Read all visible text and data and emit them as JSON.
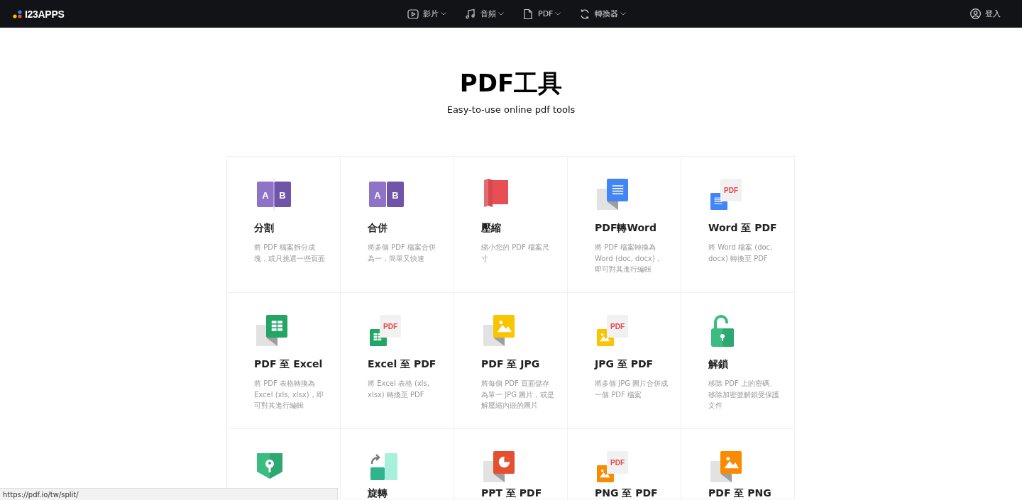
{
  "header": {
    "logo": "I23APPS",
    "nav": [
      {
        "label": "影片"
      },
      {
        "label": "音頻"
      },
      {
        "label": "PDF"
      },
      {
        "label": "轉換器"
      }
    ],
    "login": "登入"
  },
  "title": "PDF工具",
  "subtitle": "Easy-to-use online pdf tools",
  "tools": [
    {
      "kind": "split",
      "icon_text": [
        "A",
        "B"
      ],
      "title": "分割",
      "description": "將 PDF 檔案拆分成塊，或只挑選一些頁面"
    },
    {
      "kind": "merge",
      "icon_text": [
        "A",
        "B"
      ],
      "title": "合併",
      "description": "將多個 PDF 檔案合併為一，簡單又快速"
    },
    {
      "kind": "compress",
      "title": "壓縮",
      "description": "縮小您的 PDF 檔案尺寸"
    },
    {
      "kind": "to-word",
      "title": "PDF轉Word",
      "description": "將 PDF 檔案轉換為 Word (doc, docx)，即可對其進行編輯"
    },
    {
      "kind": "from-word",
      "icon_text": [
        "PDF"
      ],
      "title": "Word 至 PDF",
      "description": "將 Word 檔案 (doc, docx) 轉換至 PDF"
    },
    {
      "kind": "to-excel",
      "title": "PDF 至 Excel",
      "description": "將 PDF 表格轉換為 Excel (xls, xlsx)，即可對其進行編輯"
    },
    {
      "kind": "from-excel",
      "icon_text": [
        "PDF"
      ],
      "title": "Excel 至 PDF",
      "description": "將 Excel 表格 (xls, xlsx) 轉換至 PDF"
    },
    {
      "kind": "to-jpg",
      "title": "PDF 至 JPG",
      "description": "將每個 PDF 頁面儲存為單一 JPG 圖片，或是解壓縮內嵌的圖片"
    },
    {
      "kind": "from-jpg",
      "icon_text": [
        "PDF"
      ],
      "title": "JPG 至 PDF",
      "description": "將多個 JPG 圖片合併成一個 PDF 檔案"
    },
    {
      "kind": "unlock",
      "title": "解鎖",
      "description": "移除 PDF 上的密碼、移除加密並解鎖受保護文件"
    },
    {
      "kind": "protect"
    },
    {
      "kind": "rotate",
      "title": "旋轉"
    },
    {
      "kind": "to-ppt",
      "title": "PPT 至 PDF"
    },
    {
      "kind": "from-png",
      "icon_text": [
        "PDF"
      ],
      "title": "PNG 至 PDF"
    },
    {
      "kind": "to-png",
      "title": "PDF 至 PNG"
    }
  ],
  "status_bar": "https://pdf.io/tw/split/"
}
